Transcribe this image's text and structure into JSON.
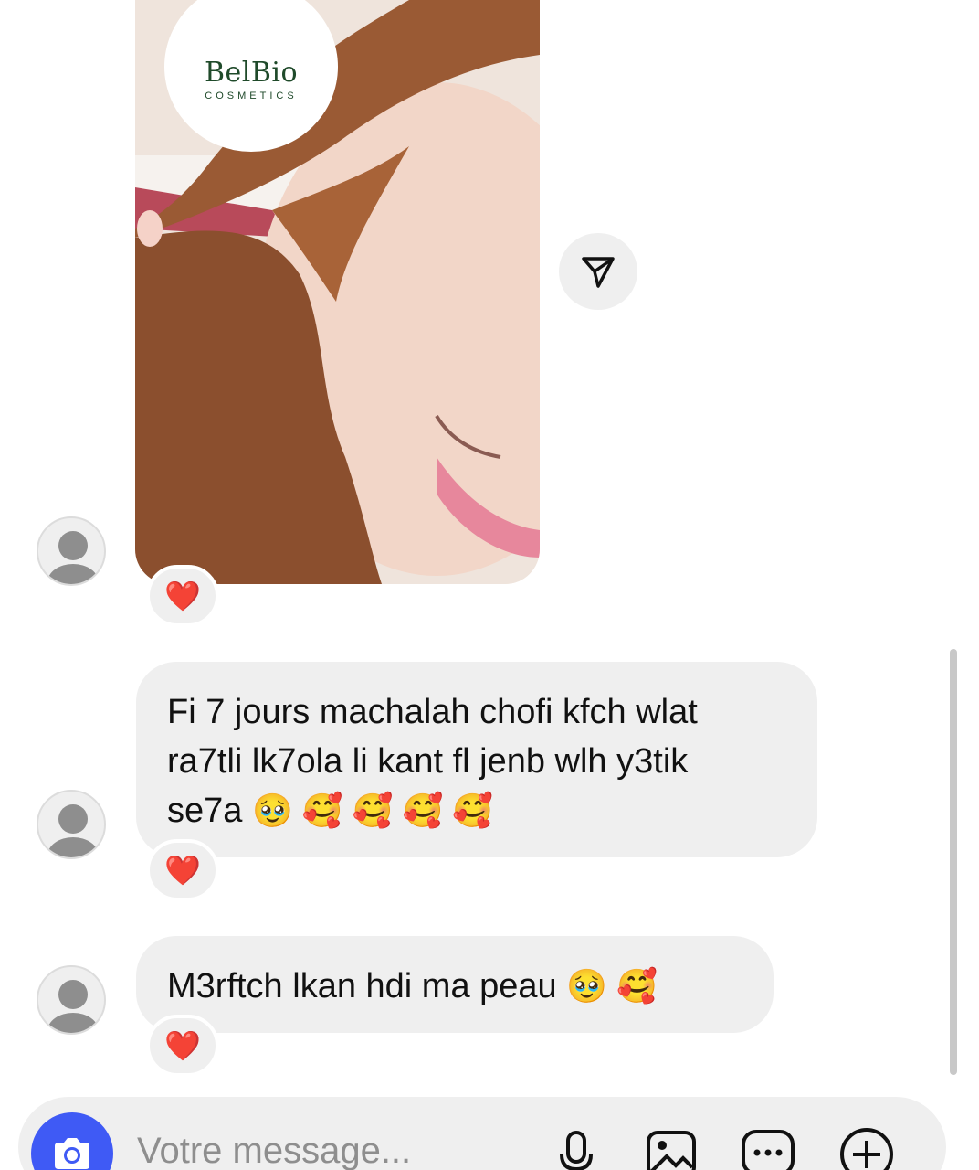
{
  "post": {
    "brand_name": "BelBio",
    "brand_subtitle": "COSMETICS",
    "share_icon": "paper-plane-icon"
  },
  "messages": [
    {
      "type": "photo",
      "reaction": "❤️"
    },
    {
      "type": "text",
      "line1": "Fi 7 jours machalah chofi kfch wlat",
      "line2": "ra7tli lk7ola li kant fl jenb wlh y3tik",
      "line3": "se7a",
      "emojis": "🥹 🥰 🥰 🥰 🥰",
      "reaction": "❤️"
    },
    {
      "type": "text",
      "text": "M3rftch lkan hdi ma peau",
      "emojis": "🥹 🥰",
      "reaction": "❤️"
    }
  ],
  "composer": {
    "placeholder": "Votre message...",
    "icons": [
      "camera-icon",
      "microphone-icon",
      "image-icon",
      "sticker-chat-icon",
      "plus-circle-icon"
    ]
  },
  "colors": {
    "bubble_bg": "#efefef",
    "camera_accent": "#3f5af5",
    "reaction_heart": "#e0262f",
    "brand_green": "#1f4a2a"
  }
}
